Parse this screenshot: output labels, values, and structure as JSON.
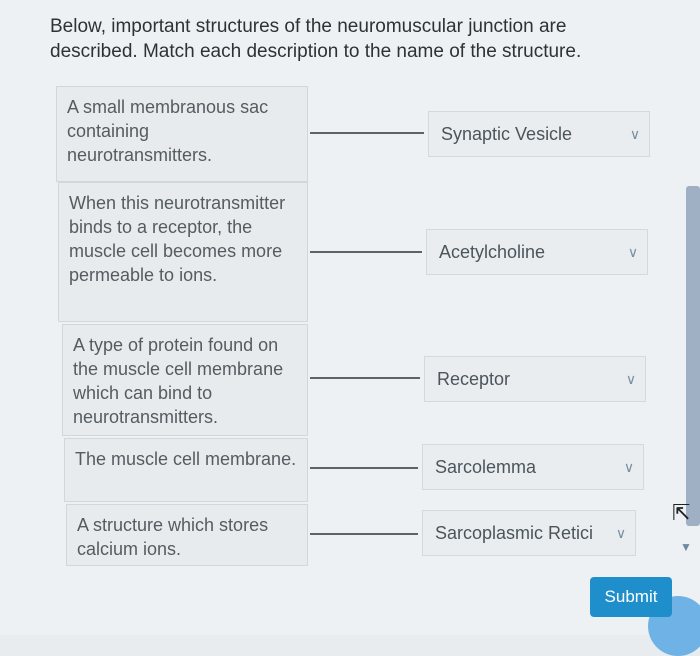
{
  "prompt": "Below, important structures of the neuromuscular junction are described. Match each description to the name of the structure.",
  "rows": [
    {
      "description": "A small membranous sac containing neurotransmitters.",
      "selected": "Synaptic Vesicle"
    },
    {
      "description": "When this neurotransmitter binds to a receptor, the muscle cell becomes more permeable to ions.",
      "selected": "Acetylcholine"
    },
    {
      "description": "A type of protein found on the muscle cell membrane which can bind to neurotransmitters.",
      "selected": "Receptor"
    },
    {
      "description": "The muscle cell membrane.",
      "selected": "Sarcolemma"
    },
    {
      "description": "A structure which stores calcium ions.",
      "selected": "Sarcoplasmic Retici"
    }
  ],
  "submit_label": "Submit",
  "icons": {
    "dropdown": "chevron-down-icon",
    "cursor": "mouse-cursor-icon"
  }
}
